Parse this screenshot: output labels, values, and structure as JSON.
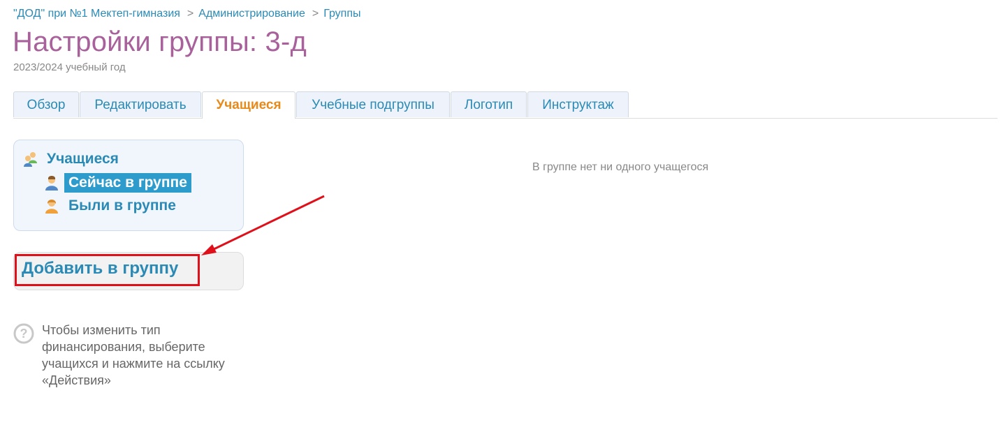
{
  "breadcrumb": {
    "items": [
      "\"ДОД\" при №1 Мектеп-гимназия",
      "Администрирование",
      "Группы"
    ],
    "separator": ">"
  },
  "header": {
    "title": "Настройки группы: 3-д",
    "subtitle": "2023/2024 учебный год"
  },
  "tabs": [
    {
      "label": "Обзор",
      "active": false
    },
    {
      "label": "Редактировать",
      "active": false
    },
    {
      "label": "Учащиеся",
      "active": true
    },
    {
      "label": "Учебные подгруппы",
      "active": false
    },
    {
      "label": "Логотип",
      "active": false
    },
    {
      "label": "Инструктаж",
      "active": false
    }
  ],
  "sidebar": {
    "title": "Учащиеся",
    "items": [
      {
        "label": "Сейчас в группе",
        "selected": true
      },
      {
        "label": "Были в группе",
        "selected": false
      }
    ]
  },
  "actions": {
    "add_label": "Добавить в группу"
  },
  "main": {
    "empty_message": "В группе нет ни одного учащегося"
  },
  "help": {
    "text": "Чтобы изменить тип финансирования, выберите учащихся и нажмите на ссылку «Действия»"
  },
  "colors": {
    "title": "#a8619b",
    "link": "#2a8ab5",
    "active_tab": "#e88a1a",
    "selected_bg": "#2d9ccc",
    "annotation": "#e0101b"
  },
  "icons": {
    "sidebar_title": "users-group-icon",
    "current": "user-male-icon",
    "former": "user-female-icon",
    "help": "help-question-icon"
  }
}
